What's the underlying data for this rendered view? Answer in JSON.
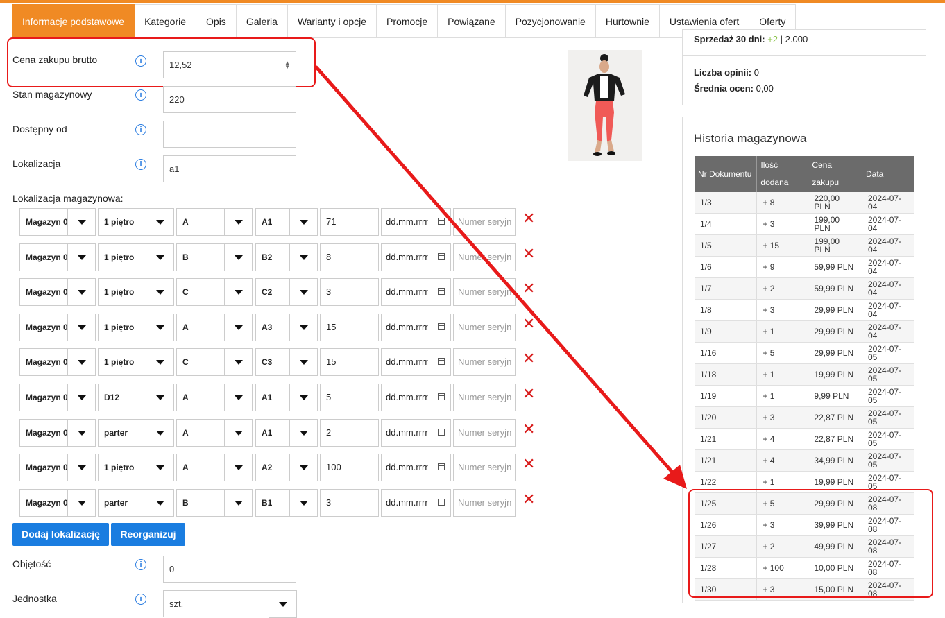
{
  "tabs": [
    {
      "label": "Informacje podstawowe",
      "active": true
    },
    {
      "label": "Kategorie"
    },
    {
      "label": "Opis"
    },
    {
      "label": "Galeria"
    },
    {
      "label": "Warianty i opcje"
    },
    {
      "label": "Promocje"
    },
    {
      "label": "Powiązane"
    },
    {
      "label": "Pozycjonowanie"
    },
    {
      "label": "Hurtownie"
    },
    {
      "label": "Ustawienia ofert"
    },
    {
      "label": "Oferty"
    }
  ],
  "fields": {
    "price_label": "Cena zakupu brutto",
    "price_value": "12,52",
    "stock_label": "Stan magazynowy",
    "stock_value": "220",
    "available_label": "Dostępny od",
    "available_value": "",
    "location_label": "Lokalizacja",
    "location_value": "a1",
    "warehouse_loc_label": "Lokalizacja magazynowa:",
    "volume_label": "Objętość",
    "volume_value": "0",
    "unit_label": "Jednostka",
    "unit_value": "szt."
  },
  "date_placeholder": "dd.mm.rrrr",
  "serial_placeholder": "Numer seryjn",
  "locations": [
    {
      "warehouse": "Magazyn 0",
      "floor": "1 piętro",
      "section": "A",
      "shelf": "A1",
      "qty": "71"
    },
    {
      "warehouse": "Magazyn 0",
      "floor": "1 piętro",
      "section": "B",
      "shelf": "B2",
      "qty": "8"
    },
    {
      "warehouse": "Magazyn 0",
      "floor": "1 piętro",
      "section": "C",
      "shelf": "C2",
      "qty": "3"
    },
    {
      "warehouse": "Magazyn 0",
      "floor": "1 piętro",
      "section": "A",
      "shelf": "A3",
      "qty": "15"
    },
    {
      "warehouse": "Magazyn 0",
      "floor": "1 piętro",
      "section": "C",
      "shelf": "C3",
      "qty": "15"
    },
    {
      "warehouse": "Magazyn 0",
      "floor": "D12",
      "section": "A",
      "shelf": "A1",
      "qty": "5"
    },
    {
      "warehouse": "Magazyn 0",
      "floor": "parter",
      "section": "A",
      "shelf": "A1",
      "qty": "2"
    },
    {
      "warehouse": "Magazyn 0",
      "floor": "1 piętro",
      "section": "A",
      "shelf": "A2",
      "qty": "100"
    },
    {
      "warehouse": "Magazyn 0",
      "floor": "parter",
      "section": "B",
      "shelf": "B1",
      "qty": "3"
    }
  ],
  "buttons": {
    "add_location": "Dodaj lokalizację",
    "reorganize": "Reorganizuj"
  },
  "stats": {
    "sales_label": "Sprzedaż 30 dni:",
    "sales_delta": "+2",
    "sales_total": "2.000",
    "opinions_label": "Liczba opinii:",
    "opinions_value": "0",
    "rating_label": "Średnia ocen:",
    "rating_value": "0,00"
  },
  "history": {
    "title": "Historia magazynowa",
    "headers": [
      "Nr Dokumentu",
      "Ilość dodana",
      "Cena zakupu",
      "Data"
    ],
    "rows": [
      [
        "1/3",
        "+ 8",
        "220,00 PLN",
        "2024-07-04"
      ],
      [
        "1/4",
        "+ 3",
        "199,00 PLN",
        "2024-07-04"
      ],
      [
        "1/5",
        "+ 15",
        "199,00 PLN",
        "2024-07-04"
      ],
      [
        "1/6",
        "+ 9",
        "59,99 PLN",
        "2024-07-04"
      ],
      [
        "1/7",
        "+ 2",
        "59,99 PLN",
        "2024-07-04"
      ],
      [
        "1/8",
        "+ 3",
        "29,99 PLN",
        "2024-07-04"
      ],
      [
        "1/9",
        "+ 1",
        "29,99 PLN",
        "2024-07-04"
      ],
      [
        "1/16",
        "+ 5",
        "29,99 PLN",
        "2024-07-05"
      ],
      [
        "1/18",
        "+ 1",
        "19,99 PLN",
        "2024-07-05"
      ],
      [
        "1/19",
        "+ 1",
        "9,99 PLN",
        "2024-07-05"
      ],
      [
        "1/20",
        "+ 3",
        "22,87 PLN",
        "2024-07-05"
      ],
      [
        "1/21",
        "+ 4",
        "22,87 PLN",
        "2024-07-05"
      ],
      [
        "1/21",
        "+ 4",
        "34,99 PLN",
        "2024-07-05"
      ],
      [
        "1/22",
        "+ 1",
        "19,99 PLN",
        "2024-07-05"
      ],
      [
        "1/25",
        "+ 5",
        "29,99 PLN",
        "2024-07-08"
      ],
      [
        "1/26",
        "+ 3",
        "39,99 PLN",
        "2024-07-08"
      ],
      [
        "1/27",
        "+ 2",
        "49,99 PLN",
        "2024-07-08"
      ],
      [
        "1/28",
        "+ 100",
        "10,00 PLN",
        "2024-07-08"
      ],
      [
        "1/30",
        "+ 3",
        "15,00 PLN",
        "2024-07-08"
      ]
    ]
  },
  "colors": {
    "accent": "#f08a24",
    "primary_button": "#1a7de0",
    "annotation_red": "#e81a1a",
    "delete": "#d81b1b"
  }
}
